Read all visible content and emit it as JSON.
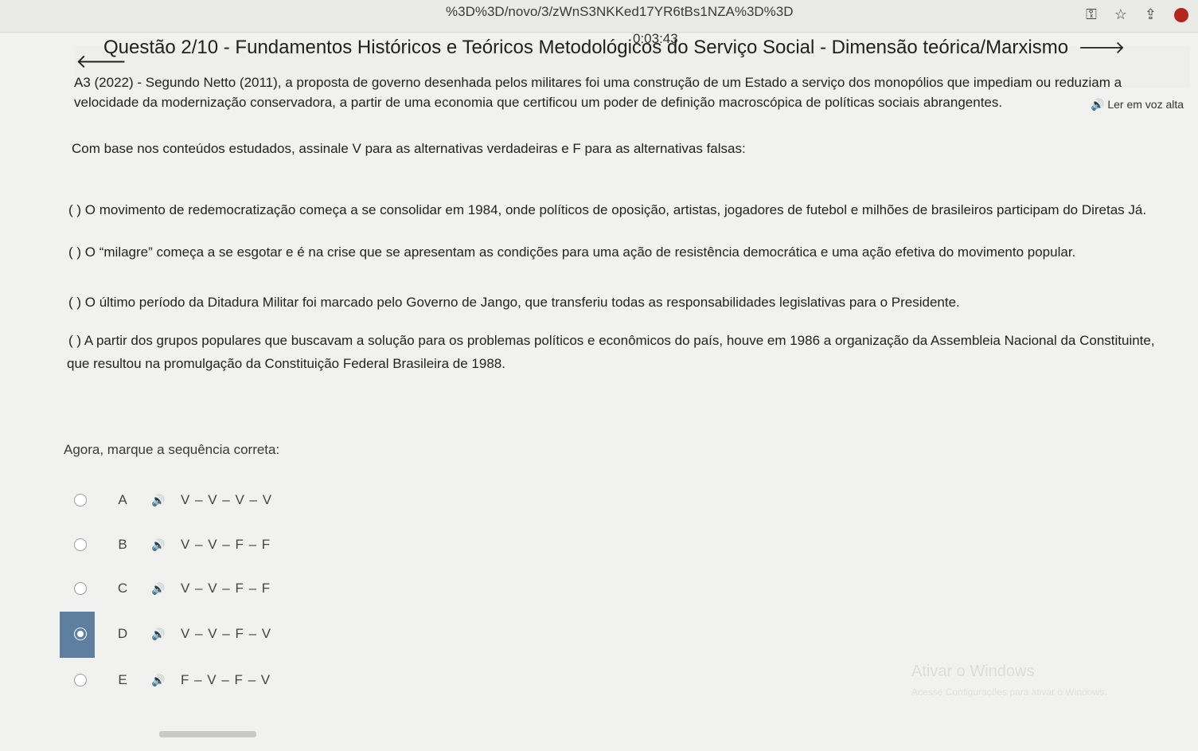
{
  "browser": {
    "url_fragment": "%3D%3D/novo/3/zWnS3NKKed17YR6tBs1NZA%3D%3D",
    "icons": [
      "key-icon",
      "star-icon",
      "share-icon",
      "profile-icon"
    ]
  },
  "timer": "0:03:43",
  "header": {
    "title": "Questão 2/10 - Fundamentos Históricos e Teóricos Metodológicos do Serviço Social - Dimensão teórica/Marxismo"
  },
  "read_aloud": "Ler em voz alta",
  "question": {
    "line1": "A3 (2022) - Segundo Netto (2011), a proposta de governo desenhada pelos militares foi uma construção de um Estado a serviço dos monopólios que impediam ou reduziam a",
    "line2": "velocidade da modernização conservadora, a partir de uma economia que certificou um poder de definição macroscópica de políticas sociais abrangentes.",
    "instruction": "Com base nos conteúdos estudados, assinale V para as alternativas verdadeiras e F para as alternativas falsas:",
    "items": [
      "(  ) O movimento de redemocratização começa a se consolidar em 1984, onde políticos de oposição, artistas, jogadores de futebol e milhões de brasileiros participam do Diretas Já.",
      "(  ) O “milagre” começa a se esgotar e é na crise que se apresentam as condições para uma ação de resistência democrática e uma ação efetiva do movimento popular.",
      "(  ) O último período da Ditadura Militar foi marcado pelo Governo de Jango, que transferiu todas as responsabilidades legislativas para o Presidente.",
      "(  ) A partir dos grupos populares que buscavam a solução para os problemas políticos e econômicos do país, houve em 1986 a organização da Assembleia Nacional da Constituinte,"
    ],
    "item4_line2": "que resultou na promulgação da Constituição Federal Brasileira de 1988.",
    "sequence_label": "Agora, marque a sequência correta:"
  },
  "options": [
    {
      "letter": "A",
      "text": "V – V – V – V",
      "selected": false
    },
    {
      "letter": "B",
      "text": "V – V – F – F",
      "selected": false
    },
    {
      "letter": "C",
      "text": "V – V – F – F",
      "selected": false
    },
    {
      "letter": "D",
      "text": "V – V – F – V",
      "selected": true
    },
    {
      "letter": "E",
      "text": "F – V – F – V",
      "selected": false
    }
  ],
  "watermark": {
    "line1": "Ativar o Windows",
    "line2": "Acesse Configurações para ativar o Windows."
  },
  "colors": {
    "selected": "#5f7fa1",
    "background": "#f1f1ef"
  }
}
